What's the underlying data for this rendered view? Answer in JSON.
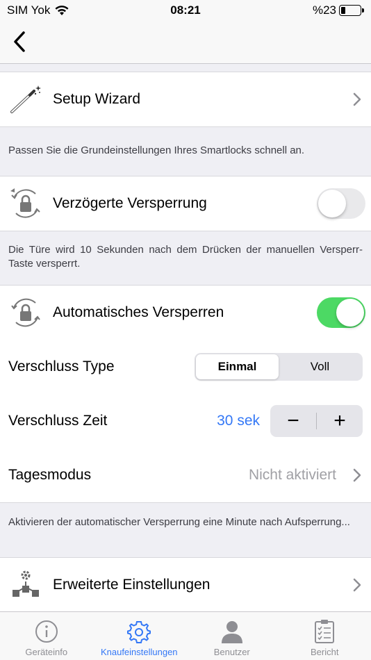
{
  "status_bar": {
    "carrier": "SIM Yok",
    "time": "08:21",
    "battery_text": "%23",
    "battery_level": 0.23
  },
  "navbar": {
    "back_icon": "chevron-left-icon"
  },
  "setup_wizard": {
    "label": "Setup Wizard",
    "icon": "magic-wand-icon",
    "footer": "Passen Sie die Grundeinstellungen Ihres Smartlocks schnell an."
  },
  "delayed_lock": {
    "label": "Verzögerte Versperrung",
    "icon": "timed-lock-icon",
    "enabled": false,
    "footer": "Die Türe wird 10 Sekunden nach dem Drücken der manuellen Versperr-Taste versperrt."
  },
  "auto_lock": {
    "label": "Automatisches Versperren",
    "icon": "auto-lock-icon",
    "enabled": true
  },
  "lock_type": {
    "label": "Verschluss Type",
    "options": [
      "Einmal",
      "Voll"
    ],
    "selected": "Einmal"
  },
  "lock_time": {
    "label": "Verschluss Zeit",
    "value": "30 sek",
    "minus": "−",
    "plus": "+"
  },
  "day_mode": {
    "label": "Tagesmodus",
    "value": "Nicht aktiviert",
    "footer": "Aktivieren der automatischer Versperrung eine Minute nach Aufsperrung..."
  },
  "advanced": {
    "label": "Erweiterte Einstellungen",
    "icon": "advanced-settings-icon"
  },
  "tabbar": {
    "tabs": [
      {
        "label": "Geräteinfo",
        "icon": "info-icon",
        "active": false
      },
      {
        "label": "Knaufeinstellungen",
        "icon": "gear-icon",
        "active": true
      },
      {
        "label": "Benutzer",
        "icon": "user-icon",
        "active": false
      },
      {
        "label": "Bericht",
        "icon": "clipboard-icon",
        "active": false
      }
    ]
  },
  "colors": {
    "accent": "#3478f6",
    "switch_on": "#4cd964",
    "background": "#efeff4"
  }
}
